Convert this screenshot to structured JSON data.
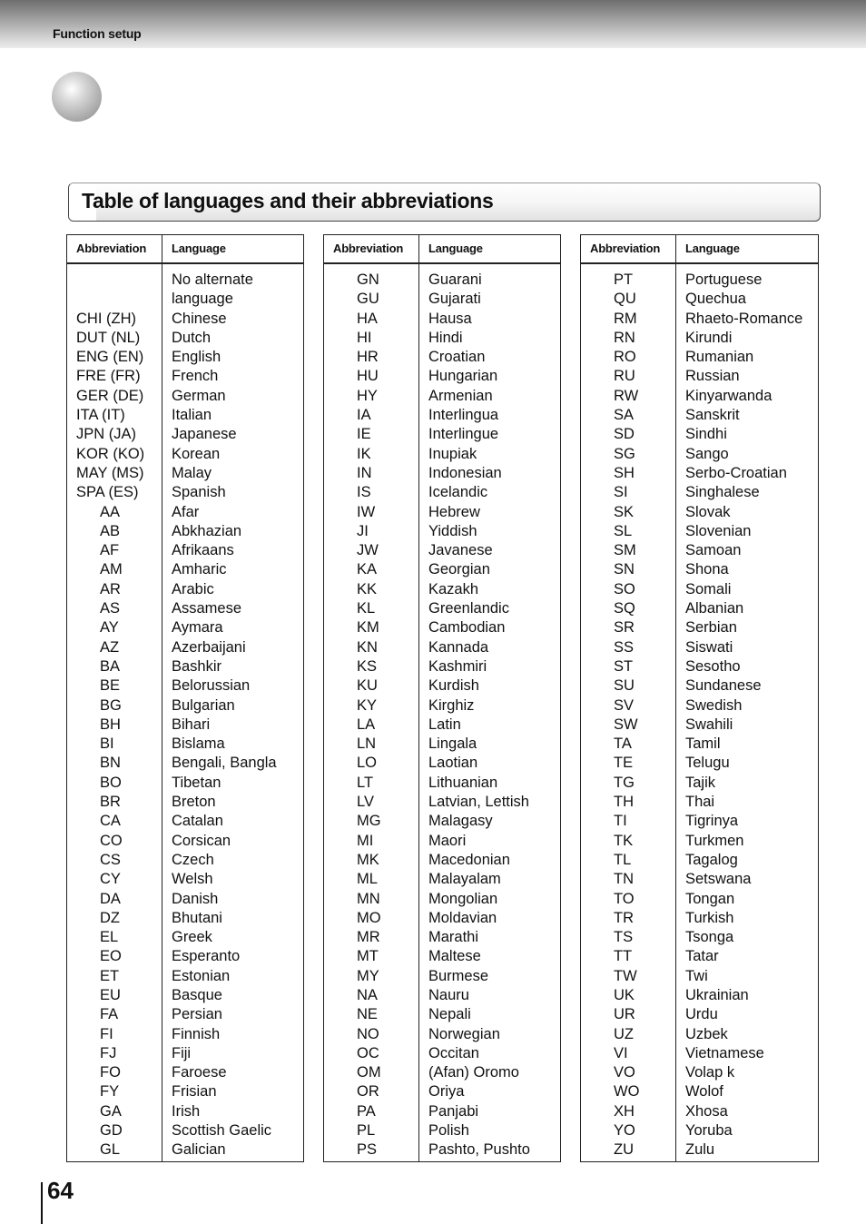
{
  "header": {
    "section_label": "Function setup"
  },
  "title": "Table of languages and their abbreviations",
  "tables": [
    {
      "headers": {
        "abbreviation": "Abbreviation",
        "language": "Language"
      },
      "rows": [
        {
          "abbr": "",
          "lang": "No alternate"
        },
        {
          "abbr": "",
          "lang": "language"
        },
        {
          "abbr": "CHI (ZH)",
          "lang": "Chinese"
        },
        {
          "abbr": "DUT (NL)",
          "lang": "Dutch"
        },
        {
          "abbr": "ENG (EN)",
          "lang": "English"
        },
        {
          "abbr": "FRE (FR)",
          "lang": "French"
        },
        {
          "abbr": "GER (DE)",
          "lang": "German"
        },
        {
          "abbr": "ITA (IT)",
          "lang": "Italian"
        },
        {
          "abbr": "JPN (JA)",
          "lang": "Japanese"
        },
        {
          "abbr": "KOR (KO)",
          "lang": "Korean"
        },
        {
          "abbr": "MAY (MS)",
          "lang": "Malay"
        },
        {
          "abbr": "SPA (ES)",
          "lang": "Spanish"
        },
        {
          "abbr": "AA",
          "lang": "Afar"
        },
        {
          "abbr": "AB",
          "lang": "Abkhazian"
        },
        {
          "abbr": "AF",
          "lang": "Afrikaans"
        },
        {
          "abbr": "AM",
          "lang": "Amharic"
        },
        {
          "abbr": "AR",
          "lang": "Arabic"
        },
        {
          "abbr": "AS",
          "lang": "Assamese"
        },
        {
          "abbr": "AY",
          "lang": "Aymara"
        },
        {
          "abbr": "AZ",
          "lang": "Azerbaijani"
        },
        {
          "abbr": "BA",
          "lang": "Bashkir"
        },
        {
          "abbr": "BE",
          "lang": "Belorussian"
        },
        {
          "abbr": "BG",
          "lang": "Bulgarian"
        },
        {
          "abbr": "BH",
          "lang": "Bihari"
        },
        {
          "abbr": "BI",
          "lang": "Bislama"
        },
        {
          "abbr": "BN",
          "lang": "Bengali, Bangla"
        },
        {
          "abbr": "BO",
          "lang": "Tibetan"
        },
        {
          "abbr": "BR",
          "lang": "Breton"
        },
        {
          "abbr": "CA",
          "lang": "Catalan"
        },
        {
          "abbr": "CO",
          "lang": "Corsican"
        },
        {
          "abbr": "CS",
          "lang": "Czech"
        },
        {
          "abbr": "CY",
          "lang": "Welsh"
        },
        {
          "abbr": "DA",
          "lang": "Danish"
        },
        {
          "abbr": "DZ",
          "lang": "Bhutani"
        },
        {
          "abbr": "EL",
          "lang": "Greek"
        },
        {
          "abbr": "EO",
          "lang": "Esperanto"
        },
        {
          "abbr": "ET",
          "lang": "Estonian"
        },
        {
          "abbr": "EU",
          "lang": "Basque"
        },
        {
          "abbr": "FA",
          "lang": "Persian"
        },
        {
          "abbr": "FI",
          "lang": "Finnish"
        },
        {
          "abbr": "FJ",
          "lang": "Fiji"
        },
        {
          "abbr": "FO",
          "lang": "Faroese"
        },
        {
          "abbr": "FY",
          "lang": "Frisian"
        },
        {
          "abbr": "GA",
          "lang": "Irish"
        },
        {
          "abbr": "GD",
          "lang": "Scottish Gaelic"
        },
        {
          "abbr": "GL",
          "lang": "Galician"
        }
      ]
    },
    {
      "headers": {
        "abbreviation": "Abbreviation",
        "language": "Language"
      },
      "rows": [
        {
          "abbr": "GN",
          "lang": "Guarani"
        },
        {
          "abbr": "GU",
          "lang": "Gujarati"
        },
        {
          "abbr": "HA",
          "lang": "Hausa"
        },
        {
          "abbr": "HI",
          "lang": "Hindi"
        },
        {
          "abbr": "HR",
          "lang": "Croatian"
        },
        {
          "abbr": "HU",
          "lang": "Hungarian"
        },
        {
          "abbr": "HY",
          "lang": "Armenian"
        },
        {
          "abbr": "IA",
          "lang": "Interlingua"
        },
        {
          "abbr": "IE",
          "lang": "Interlingue"
        },
        {
          "abbr": "IK",
          "lang": "Inupiak"
        },
        {
          "abbr": "IN",
          "lang": "Indonesian"
        },
        {
          "abbr": "IS",
          "lang": "Icelandic"
        },
        {
          "abbr": "IW",
          "lang": "Hebrew"
        },
        {
          "abbr": "JI",
          "lang": "Yiddish"
        },
        {
          "abbr": "JW",
          "lang": "Javanese"
        },
        {
          "abbr": "KA",
          "lang": "Georgian"
        },
        {
          "abbr": "KK",
          "lang": "Kazakh"
        },
        {
          "abbr": "KL",
          "lang": "Greenlandic"
        },
        {
          "abbr": "KM",
          "lang": "Cambodian"
        },
        {
          "abbr": "KN",
          "lang": "Kannada"
        },
        {
          "abbr": "KS",
          "lang": "Kashmiri"
        },
        {
          "abbr": "KU",
          "lang": "Kurdish"
        },
        {
          "abbr": "KY",
          "lang": "Kirghiz"
        },
        {
          "abbr": "LA",
          "lang": "Latin"
        },
        {
          "abbr": "LN",
          "lang": "Lingala"
        },
        {
          "abbr": "LO",
          "lang": "Laotian"
        },
        {
          "abbr": "LT",
          "lang": "Lithuanian"
        },
        {
          "abbr": "LV",
          "lang": "Latvian, Lettish"
        },
        {
          "abbr": "MG",
          "lang": "Malagasy"
        },
        {
          "abbr": "MI",
          "lang": "Maori"
        },
        {
          "abbr": "MK",
          "lang": "Macedonian"
        },
        {
          "abbr": "ML",
          "lang": "Malayalam"
        },
        {
          "abbr": "MN",
          "lang": "Mongolian"
        },
        {
          "abbr": "MO",
          "lang": "Moldavian"
        },
        {
          "abbr": "MR",
          "lang": "Marathi"
        },
        {
          "abbr": "MT",
          "lang": "Maltese"
        },
        {
          "abbr": "MY",
          "lang": "Burmese"
        },
        {
          "abbr": "NA",
          "lang": "Nauru"
        },
        {
          "abbr": "NE",
          "lang": "Nepali"
        },
        {
          "abbr": "NO",
          "lang": "Norwegian"
        },
        {
          "abbr": "OC",
          "lang": "Occitan"
        },
        {
          "abbr": "OM",
          "lang": "(Afan) Oromo"
        },
        {
          "abbr": "OR",
          "lang": "Oriya"
        },
        {
          "abbr": "PA",
          "lang": "Panjabi"
        },
        {
          "abbr": "PL",
          "lang": "Polish"
        },
        {
          "abbr": "PS",
          "lang": "Pashto, Pushto"
        }
      ]
    },
    {
      "headers": {
        "abbreviation": "Abbreviation",
        "language": "Language"
      },
      "rows": [
        {
          "abbr": "PT",
          "lang": "Portuguese"
        },
        {
          "abbr": "QU",
          "lang": "Quechua"
        },
        {
          "abbr": "RM",
          "lang": "Rhaeto-Romance"
        },
        {
          "abbr": "RN",
          "lang": "Kirundi"
        },
        {
          "abbr": "RO",
          "lang": "Rumanian"
        },
        {
          "abbr": "RU",
          "lang": "Russian"
        },
        {
          "abbr": "RW",
          "lang": "Kinyarwanda"
        },
        {
          "abbr": "SA",
          "lang": "Sanskrit"
        },
        {
          "abbr": "SD",
          "lang": "Sindhi"
        },
        {
          "abbr": "SG",
          "lang": "Sango"
        },
        {
          "abbr": "SH",
          "lang": "Serbo-Croatian"
        },
        {
          "abbr": "SI",
          "lang": "Singhalese"
        },
        {
          "abbr": "SK",
          "lang": "Slovak"
        },
        {
          "abbr": "SL",
          "lang": "Slovenian"
        },
        {
          "abbr": "SM",
          "lang": "Samoan"
        },
        {
          "abbr": "SN",
          "lang": "Shona"
        },
        {
          "abbr": "SO",
          "lang": "Somali"
        },
        {
          "abbr": "SQ",
          "lang": "Albanian"
        },
        {
          "abbr": "SR",
          "lang": "Serbian"
        },
        {
          "abbr": "SS",
          "lang": "Siswati"
        },
        {
          "abbr": "ST",
          "lang": "Sesotho"
        },
        {
          "abbr": "SU",
          "lang": "Sundanese"
        },
        {
          "abbr": "SV",
          "lang": "Swedish"
        },
        {
          "abbr": "SW",
          "lang": "Swahili"
        },
        {
          "abbr": "TA",
          "lang": "Tamil"
        },
        {
          "abbr": "TE",
          "lang": "Telugu"
        },
        {
          "abbr": "TG",
          "lang": "Tajik"
        },
        {
          "abbr": "TH",
          "lang": "Thai"
        },
        {
          "abbr": "TI",
          "lang": "Tigrinya"
        },
        {
          "abbr": "TK",
          "lang": "Turkmen"
        },
        {
          "abbr": "TL",
          "lang": "Tagalog"
        },
        {
          "abbr": "TN",
          "lang": "Setswana"
        },
        {
          "abbr": "TO",
          "lang": "Tongan"
        },
        {
          "abbr": "TR",
          "lang": "Turkish"
        },
        {
          "abbr": "TS",
          "lang": "Tsonga"
        },
        {
          "abbr": "TT",
          "lang": "Tatar"
        },
        {
          "abbr": "TW",
          "lang": "Twi"
        },
        {
          "abbr": "UK",
          "lang": "Ukrainian"
        },
        {
          "abbr": "UR",
          "lang": "Urdu"
        },
        {
          "abbr": "UZ",
          "lang": "Uzbek"
        },
        {
          "abbr": "VI",
          "lang": "Vietnamese"
        },
        {
          "abbr": "VO",
          "lang": "Volap  k"
        },
        {
          "abbr": "WO",
          "lang": "Wolof"
        },
        {
          "abbr": "XH",
          "lang": "Xhosa"
        },
        {
          "abbr": "YO",
          "lang": "Yoruba"
        },
        {
          "abbr": "ZU",
          "lang": "Zulu"
        }
      ]
    }
  ],
  "page_number": "64"
}
